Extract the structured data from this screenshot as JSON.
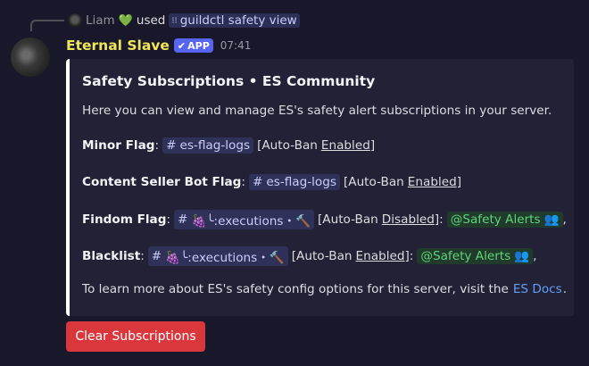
{
  "reply": {
    "user": "Liam",
    "emoji": "💚",
    "used": "used",
    "command": "guildctl safety view",
    "command_icon": "slash-command-icon"
  },
  "message": {
    "author": "Eternal Slave",
    "badge": "APP",
    "badge_check": "✔",
    "timestamp": "07:41"
  },
  "embed": {
    "accent_color": "#ffffff",
    "title": "Safety Subscriptions • ES Community",
    "description": "Here you can view and manage ES's safety alert subscriptions in your server.",
    "lines": [
      {
        "label": "Minor Flag",
        "channel": "es-flag-logs",
        "pre": "[Auto-Ban",
        "status": "Enabled",
        "post": "]"
      },
      {
        "label": "Content Seller Bot Flag",
        "channel": "es-flag-logs",
        "pre": "[Auto-Ban",
        "status": "Enabled",
        "post": "]"
      },
      {
        "label": "Findom Flag",
        "channel": "🍇╰:executions・🔨",
        "pre": "[Auto-Ban",
        "status": "Disabled",
        "post": "]:",
        "role": "@Safety Alerts",
        "tail": ","
      },
      {
        "label": "Blacklist",
        "channel": "🍇╰:executions・🔨",
        "pre": "[Auto-Ban",
        "status": "Enabled",
        "post": "]:",
        "role": "@Safety Alerts",
        "tail": ","
      }
    ],
    "footer_pre": "To learn more about ES's safety config options for this server, visit the",
    "footer_link": "ES Docs",
    "footer_post": "."
  },
  "buttons": {
    "clear": "Clear Subscriptions"
  },
  "colors": {
    "author": "#f0e659",
    "app_badge": "#5865f2",
    "role_mention": "#5fd37a",
    "danger_button": "#da373c",
    "link": "#61a0f8"
  }
}
